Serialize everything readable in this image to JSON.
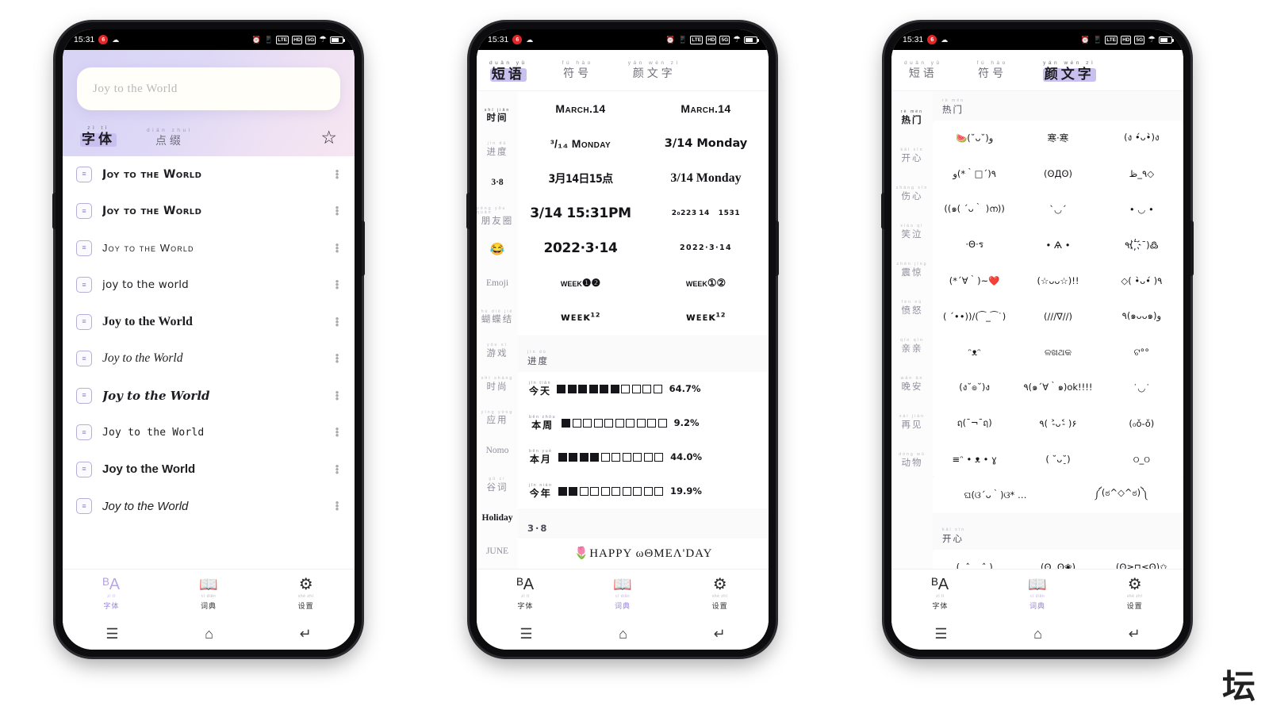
{
  "status_bar": {
    "time": "15:31",
    "icons": [
      "alarm-icon",
      "vibrate-icon",
      "lte-badge",
      "hd-badge",
      "5g-badge",
      "wifi-icon",
      "battery-icon"
    ],
    "lte_label": "LTE",
    "hd_label": "HD",
    "fiveg_label": "5G"
  },
  "nav_bar": {
    "recents": "☰",
    "home": "⌂",
    "back": "↵"
  },
  "tabbar": {
    "items": [
      {
        "icon": "script-a-icon",
        "glyph": "ᴮA",
        "pinyin": "zì tǐ",
        "label": "字体"
      },
      {
        "icon": "open-book-icon",
        "glyph": "📖",
        "pinyin": "cí diǎn",
        "label": "词典"
      },
      {
        "icon": "gear-icon",
        "glyph": "⚙",
        "pinyin": "shè zhì",
        "label": "设置"
      }
    ]
  },
  "phone1": {
    "active_tab_index": 0,
    "search": {
      "placeholder": "Joy to the World",
      "value": ""
    },
    "section_tabs": [
      {
        "pinyin": "zì tǐ",
        "label": "字体",
        "selected": true
      },
      {
        "pinyin": "diǎn zhuì",
        "label": "点缀",
        "selected": false
      }
    ],
    "favorite_icon": "star-outline-icon",
    "font_rows": [
      {
        "text": "Joy to the World",
        "style": "fs0"
      },
      {
        "text": "Joy to the World",
        "style": "fs1"
      },
      {
        "text": "Joy to the World",
        "style": "fs2"
      },
      {
        "text": "joy to the world",
        "style": "fs3"
      },
      {
        "text": "Joy to the World",
        "style": "fs4"
      },
      {
        "text": "Joy to the World",
        "style": "fs5"
      },
      {
        "text": "Joy to the World",
        "style": "fs6"
      },
      {
        "text": "Joy to the World",
        "style": "fs7"
      },
      {
        "text": "Joy to the World",
        "style": "fs8"
      },
      {
        "text": "Joy to the World",
        "style": "fs9"
      }
    ]
  },
  "phone2": {
    "active_tab_index": 1,
    "top_tabs": [
      {
        "pinyin": "duǎn yǔ",
        "label": "短语",
        "selected": true
      },
      {
        "pinyin": "fú hào",
        "label": "符号",
        "selected": false
      },
      {
        "pinyin": "yán wén zì",
        "label": "颜文字",
        "selected": false
      }
    ],
    "sidebar": [
      {
        "pinyin": "shí jiān",
        "label": "时间",
        "active": true,
        "kind": "cn"
      },
      {
        "pinyin": "jìn dù",
        "label": "进度",
        "active": false,
        "kind": "cn"
      },
      {
        "pinyin": "",
        "label": "3·8",
        "active": false,
        "kind": "plain-bold"
      },
      {
        "pinyin": "péng yǒu quān",
        "label": "朋友圈",
        "active": false,
        "kind": "cn"
      },
      {
        "pinyin": "",
        "label": "😂",
        "active": false,
        "kind": "emoji"
      },
      {
        "pinyin": "",
        "label": "Emoji",
        "active": false,
        "kind": "plain"
      },
      {
        "pinyin": "hú dié jié",
        "label": "蝴蝶结",
        "active": false,
        "kind": "cn"
      },
      {
        "pinyin": "yóu xì",
        "label": "游戏",
        "active": false,
        "kind": "cn"
      },
      {
        "pinyin": "shí shàng",
        "label": "时尚",
        "active": false,
        "kind": "cn"
      },
      {
        "pinyin": "yìng yòng",
        "label": "应用",
        "active": false,
        "kind": "cn"
      },
      {
        "pinyin": "",
        "label": "Nomo",
        "active": false,
        "kind": "plain"
      },
      {
        "pinyin": "gǔ cí",
        "label": "谷词",
        "active": false,
        "kind": "cn"
      },
      {
        "pinyin": "",
        "label": "Holiday",
        "active": false,
        "kind": "plain-bold"
      },
      {
        "pinyin": "",
        "label": "JUNE",
        "active": false,
        "kind": "plain"
      }
    ],
    "time_section": {
      "cells": [
        {
          "text": "March.14",
          "style": "pv0"
        },
        {
          "text": "March.14",
          "style": "pv0"
        },
        {
          "text": "³/₁₄ Monday",
          "style": "pv0"
        },
        {
          "text": "3/14 Monday",
          "style": "pv1"
        },
        {
          "text": "3月14日15点",
          "style": "pv2"
        },
        {
          "text": "3/14 Monday",
          "style": "pv3"
        },
        {
          "text": "3/14 15:31PM",
          "style": "pv4"
        },
        {
          "text": "2₀223 14    1531",
          "style": "pv5"
        },
        {
          "text": "2022·3·14",
          "style": "pv6"
        },
        {
          "text": "2022·3·14",
          "style": "pv7"
        },
        {
          "text": "week❶❷",
          "style": "pv8"
        },
        {
          "text": "week①②",
          "style": "pv8"
        },
        {
          "text": "ᴡᴇᴇᴋ¹²",
          "style": "pv9"
        },
        {
          "text": "ᴡᴇᴇᴋ¹²",
          "style": "pv9"
        }
      ]
    },
    "progress_section": {
      "pinyin": "jìn dù",
      "label": "进度",
      "rows": [
        {
          "pinyin": "jīn tiān",
          "label": "今天",
          "percent": "64.7%",
          "filled": 6,
          "total": 10
        },
        {
          "pinyin": "běn zhōu",
          "label": "本周",
          "percent": "9.2%",
          "filled": 1,
          "total": 10
        },
        {
          "pinyin": "běn yuè",
          "label": "本月",
          "percent": "44.0%",
          "filled": 4,
          "total": 10
        },
        {
          "pinyin": "jīn nián",
          "label": "今年",
          "percent": "19.9%",
          "filled": 2,
          "total": 10
        }
      ]
    },
    "holiday_section": {
      "label": "3·8",
      "rows": [
        {
          "text": "🌷HAPPY ωΘMEΛ'DAY"
        }
      ]
    }
  },
  "phone3": {
    "active_tab_index": 1,
    "top_tabs": [
      {
        "pinyin": "duǎn yǔ",
        "label": "短语",
        "selected": false
      },
      {
        "pinyin": "fú hào",
        "label": "符号",
        "selected": false
      },
      {
        "pinyin": "yán wén zì",
        "label": "颜文字",
        "selected": true
      }
    ],
    "sidebar": [
      {
        "pinyin": "rè mén",
        "label": "热门",
        "active": true
      },
      {
        "pinyin": "kāi xīn",
        "label": "开心",
        "active": false
      },
      {
        "pinyin": "shāng xīn",
        "label": "伤心",
        "active": false
      },
      {
        "pinyin": "xiào qì",
        "label": "笑泣",
        "active": false
      },
      {
        "pinyin": "zhèn jīng",
        "label": "震惊",
        "active": false
      },
      {
        "pinyin": "fèn nù",
        "label": "愤怒",
        "active": false
      },
      {
        "pinyin": "qīn qīn",
        "label": "亲亲",
        "active": false
      },
      {
        "pinyin": "wǎn ān",
        "label": "晚安",
        "active": false
      },
      {
        "pinyin": "zài jiàn",
        "label": "再见",
        "active": false
      },
      {
        "pinyin": "dòng wù",
        "label": "动物",
        "active": false
      }
    ],
    "hot_section": {
      "pinyin": "rè mén",
      "label": "热门"
    },
    "hot_items": [
      "🍉(˘ᴗ˘)و",
      "寒·寒",
      "(ง •́ᴗ•̀)ง",
      "٩(´□｀*)و",
      "(ʘДʘ)",
      "٩_ظ◇",
      "((๑( ´ᴗ｀ )ന))",
      "ˋ◡ˊ",
      "• ◡ •",
      "·Θ·ร",
      "• Ѧ •",
      "٩(ˉ҉ˉ)߷",
      "(*´∀｀)~❤️",
      "(☆ᴗᴗ☆)!!",
      "◇( •̀ᴗ•́ )٩",
      "( ´••))/(⁀_⁀˙)",
      "(///∇//)",
      "٩(๑ᴗᴗ๑)و",
      "ᵔᴥᵔ",
      "ଳଖଥକ",
      "ଟ°°",
      "(ง˘๏˘)ง",
      "٩(๑´∀｀๑)ok!!!!",
      "˙◡˙",
      "ฤ(¯¬¯ฤ)",
      "٩( ˃̵ᴗ˂̵ )۶",
      "(₀ǒ-ǒ)",
      "≡ᵔ • ᴥ • ɣ",
      "( ˘ᴗ˘̠)",
      "ଠ_ଠ",
      "ଘ(ଓ´ᴗ｀)ଓ* …",
      "༼(ಠ^◇^ಠ)༽"
    ],
    "happy_section": {
      "pinyin": "kāi xīn",
      "label": "开心"
    },
    "happy_items": [
      "(. ˆ ,, ˆ.)",
      "(ʘ..ʘ❀)",
      "(ʘ≥⊓≤ʘ)✩"
    ]
  },
  "watermark": {
    "text": "坛"
  }
}
